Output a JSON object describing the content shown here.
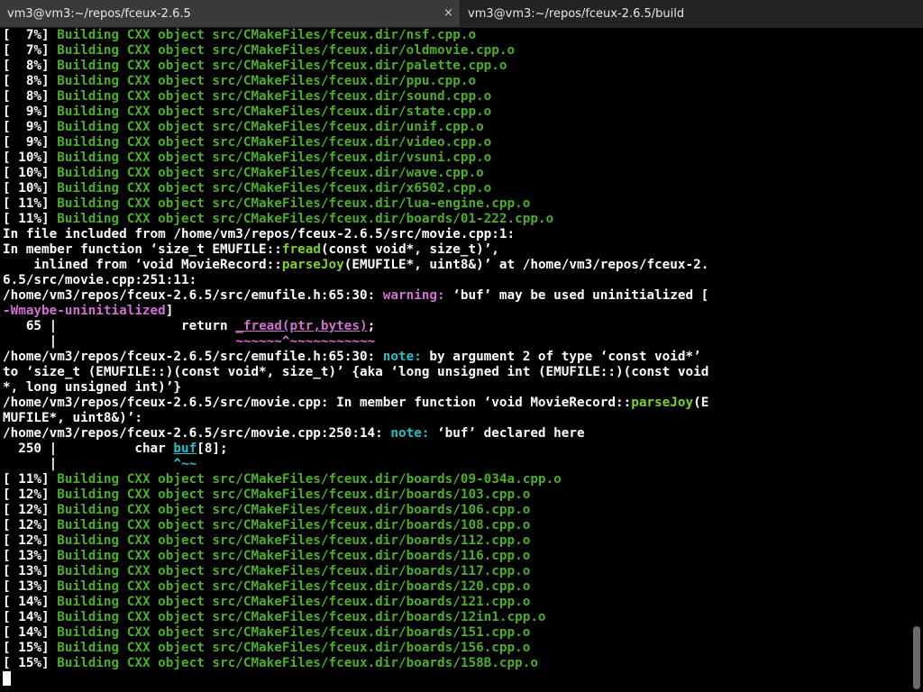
{
  "tabs": [
    {
      "title": "vm3@vm3:~/repos/fceux-2.6.5",
      "close": "×"
    },
    {
      "title": "vm3@vm3:~/repos/fceux-2.6.5/build",
      "close": "×"
    }
  ],
  "terminal": {
    "build_lines_1": [
      {
        "pct": "[  7%]",
        "text": " Building CXX object src/CMakeFiles/fceux.dir/nsf.cpp.o"
      },
      {
        "pct": "[  7%]",
        "text": " Building CXX object src/CMakeFiles/fceux.dir/oldmovie.cpp.o"
      },
      {
        "pct": "[  8%]",
        "text": " Building CXX object src/CMakeFiles/fceux.dir/palette.cpp.o"
      },
      {
        "pct": "[  8%]",
        "text": " Building CXX object src/CMakeFiles/fceux.dir/ppu.cpp.o"
      },
      {
        "pct": "[  8%]",
        "text": " Building CXX object src/CMakeFiles/fceux.dir/sound.cpp.o"
      },
      {
        "pct": "[  9%]",
        "text": " Building CXX object src/CMakeFiles/fceux.dir/state.cpp.o"
      },
      {
        "pct": "[  9%]",
        "text": " Building CXX object src/CMakeFiles/fceux.dir/unif.cpp.o"
      },
      {
        "pct": "[  9%]",
        "text": " Building CXX object src/CMakeFiles/fceux.dir/video.cpp.o"
      },
      {
        "pct": "[ 10%]",
        "text": " Building CXX object src/CMakeFiles/fceux.dir/vsuni.cpp.o"
      },
      {
        "pct": "[ 10%]",
        "text": " Building CXX object src/CMakeFiles/fceux.dir/wave.cpp.o"
      },
      {
        "pct": "[ 10%]",
        "text": " Building CXX object src/CMakeFiles/fceux.dir/x6502.cpp.o"
      },
      {
        "pct": "[ 11%]",
        "text": " Building CXX object src/CMakeFiles/fceux.dir/lua-engine.cpp.o"
      },
      {
        "pct": "[ 11%]",
        "text": " Building CXX object src/CMakeFiles/fceux.dir/boards/01-222.cpp.o"
      }
    ],
    "diag": {
      "l1a": "In file included from ",
      "l1b": "/home/vm3/repos/fceux-2.6.5/src/movie.cpp:1:",
      "l2a": "In member function ‘",
      "l2b": "size_t EMUFILE::",
      "l2c": "fread",
      "l2d": "(const void*, size_t)",
      "l2e": "’,",
      "l3a": "    inlined from ‘",
      "l3b": "void MovieRecord::",
      "l3c": "parseJoy",
      "l3d": "(EMUFILE*, uint8&)",
      "l3e": "’ at ",
      "l3f": "/home/vm3/repos/fceux-2.",
      "l4": "6.5/src/movie.cpp:251:11:",
      "l5a": "/home/vm3/repos/fceux-2.6.5/src/emufile.h:65:30: ",
      "l5b": "warning: ",
      "l5c": "‘",
      "l5d": "buf",
      "l5e": "’ may be used uninitialized [",
      "l6a": "-Wmaybe-uninitialized",
      "l6b": "]",
      "l7a": "   65 | ",
      "l7b": "               return ",
      "l7c": "_fread(ptr,bytes)",
      "l7d": ";",
      "l8a": "      | ",
      "l8b": "                      ~~~~~~^~~~~~~~~~~~",
      "l9a": "/home/vm3/repos/fceux-2.6.5/src/emufile.h:65:30: ",
      "l9b": "note: ",
      "l9c": "by argument 2 of type ‘",
      "l9d": "const void*",
      "l9e": "’",
      "l10a": "to ‘",
      "l10b": "size_t (EMUFILE::)(const void*, size_t)",
      "l10c": "’ {aka ‘",
      "l10d": "long unsigned int (EMUFILE::)(const void",
      "l11a": "*, long unsigned int)",
      "l11b": "’}",
      "l12a": "/home/vm3/repos/fceux-2.6.5/src/movie.cpp:",
      "l12b": " In member function ‘",
      "l12c": "void MovieRecord::",
      "l12d": "parseJoy",
      "l12e": "(E",
      "l13a": "MUFILE*, uint8&)",
      "l13b": "’:",
      "l14a": "/home/vm3/repos/fceux-2.6.5/src/movie.cpp:250:14: ",
      "l14b": "note: ",
      "l14c": "‘",
      "l14d": "buf",
      "l14e": "’ declared here",
      "l15a": "  250 | ",
      "l15b": "         char ",
      "l15c": "buf",
      "l15d": "[8];",
      "l16a": "      | ",
      "l16b": "              ^~~"
    },
    "build_lines_2": [
      {
        "pct": "[ 11%]",
        "text": " Building CXX object src/CMakeFiles/fceux.dir/boards/09-034a.cpp.o"
      },
      {
        "pct": "[ 12%]",
        "text": " Building CXX object src/CMakeFiles/fceux.dir/boards/103.cpp.o"
      },
      {
        "pct": "[ 12%]",
        "text": " Building CXX object src/CMakeFiles/fceux.dir/boards/106.cpp.o"
      },
      {
        "pct": "[ 12%]",
        "text": " Building CXX object src/CMakeFiles/fceux.dir/boards/108.cpp.o"
      },
      {
        "pct": "[ 12%]",
        "text": " Building CXX object src/CMakeFiles/fceux.dir/boards/112.cpp.o"
      },
      {
        "pct": "[ 13%]",
        "text": " Building CXX object src/CMakeFiles/fceux.dir/boards/116.cpp.o"
      },
      {
        "pct": "[ 13%]",
        "text": " Building CXX object src/CMakeFiles/fceux.dir/boards/117.cpp.o"
      },
      {
        "pct": "[ 13%]",
        "text": " Building CXX object src/CMakeFiles/fceux.dir/boards/120.cpp.o"
      },
      {
        "pct": "[ 14%]",
        "text": " Building CXX object src/CMakeFiles/fceux.dir/boards/121.cpp.o"
      },
      {
        "pct": "[ 14%]",
        "text": " Building CXX object src/CMakeFiles/fceux.dir/boards/12in1.cpp.o"
      },
      {
        "pct": "[ 14%]",
        "text": " Building CXX object src/CMakeFiles/fceux.dir/boards/151.cpp.o"
      },
      {
        "pct": "[ 15%]",
        "text": " Building CXX object src/CMakeFiles/fceux.dir/boards/156.cpp.o"
      },
      {
        "pct": "[ 15%]",
        "text": " Building CXX object src/CMakeFiles/fceux.dir/boards/158B.cpp.o"
      }
    ]
  },
  "colors": {
    "build_green": "#4caf28",
    "warning_magenta": "#d070d0",
    "note_cyan": "#23c0c8",
    "func_green": "#7ed321",
    "background": "#000000"
  },
  "icons": {
    "tab_close": "close-icon",
    "cursor": "terminal-cursor"
  }
}
